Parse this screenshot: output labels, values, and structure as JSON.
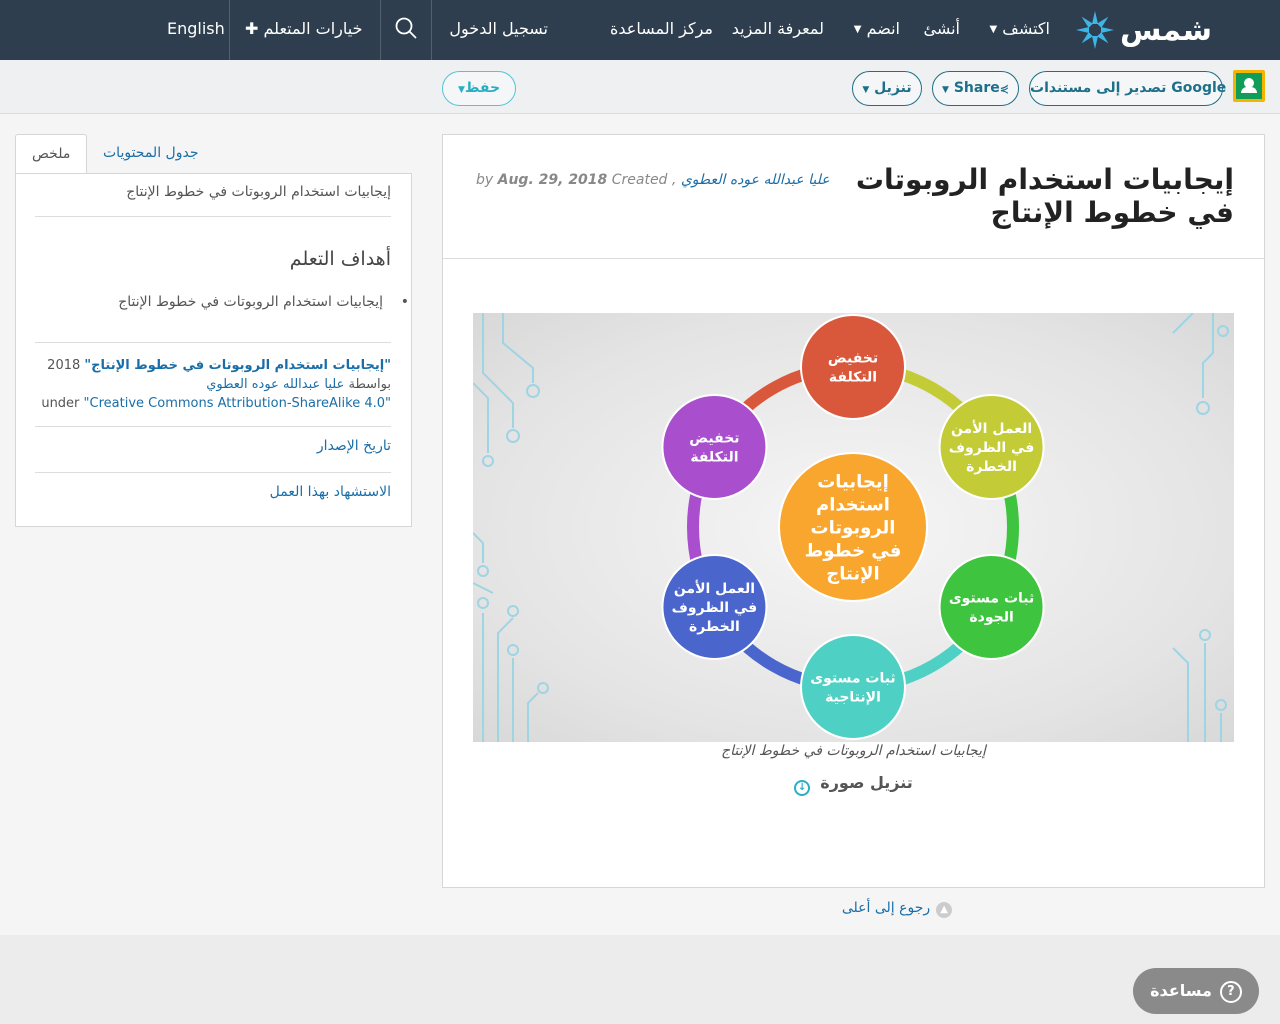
{
  "nav": {
    "logo": "شمس",
    "discover": "اكتشف",
    "create": "أنشئ",
    "join": "انضم",
    "learn_more": "لمعرفة المزيد",
    "help_center": "مركز المساعدة",
    "login": "تسجيل الدخول",
    "learner_options": "خيارات المتعلم",
    "language": "English"
  },
  "toolbar": {
    "export_google": "تصدير إلى مستندات Google",
    "share": "Share",
    "download": "تنزيل",
    "save": "حفظ"
  },
  "article": {
    "title": "إيجابيات استخدام الروبوتات في خطوط الإنتاج",
    "by": "by",
    "author": "عليا عبدالله عوده العطوي",
    "created_label": "Created",
    "date": "Aug. 29, 2018",
    "caption": "إيجابيات استخدام الروبوتات في خطوط الإنتاج",
    "download_image": "تنزيل صورة"
  },
  "diagram": {
    "center": "إيجابيات استخدام الروبوتات في خطوط الإنتاج",
    "nodes": [
      {
        "label": "تخفيض التكلفة",
        "color": "#d9583b"
      },
      {
        "label": "العمل الأمن في الظروف الخطرة",
        "color": "#c3cc36"
      },
      {
        "label": "ثبات مستوى الجودة",
        "color": "#3fc43f"
      },
      {
        "label": "ثبات مستوى الإنتاجية",
        "color": "#4fd0c4"
      },
      {
        "label": "العمل الأمن في الظروف الخطرة",
        "color": "#4a66cc"
      },
      {
        "label": "تخفيض التكلفة",
        "color": "#a94fce"
      }
    ],
    "center_color": "#f9a62f"
  },
  "sidebar": {
    "tab_summary": "ملخص",
    "tab_toc": "جدول المحتويات",
    "summary": "إيجابيات استخدام الروبوتات في خطوط الإنتاج",
    "learning_objectives": "أهداف التعلم",
    "objective": "إيجابيات استخدام الروبوتات في خطوط الإنتاج",
    "cite_title": "\"إيجابيات استخدام الروبوتات في خطوط الإنتاج\"",
    "cite_year": "2018",
    "cite_by": "بواسطة",
    "cite_author": "عليا عبدالله عوده العطوي",
    "cite_license_pre": "under ",
    "cite_license": "\"Creative Commons Attribution-ShareAlike 4.0\"",
    "release_history": "تاريخ الإصدار",
    "cite_work": "الاستشهاد بهذا العمل"
  },
  "back_to_top": "رجوع إلى أعلى",
  "help": "مساعدة"
}
